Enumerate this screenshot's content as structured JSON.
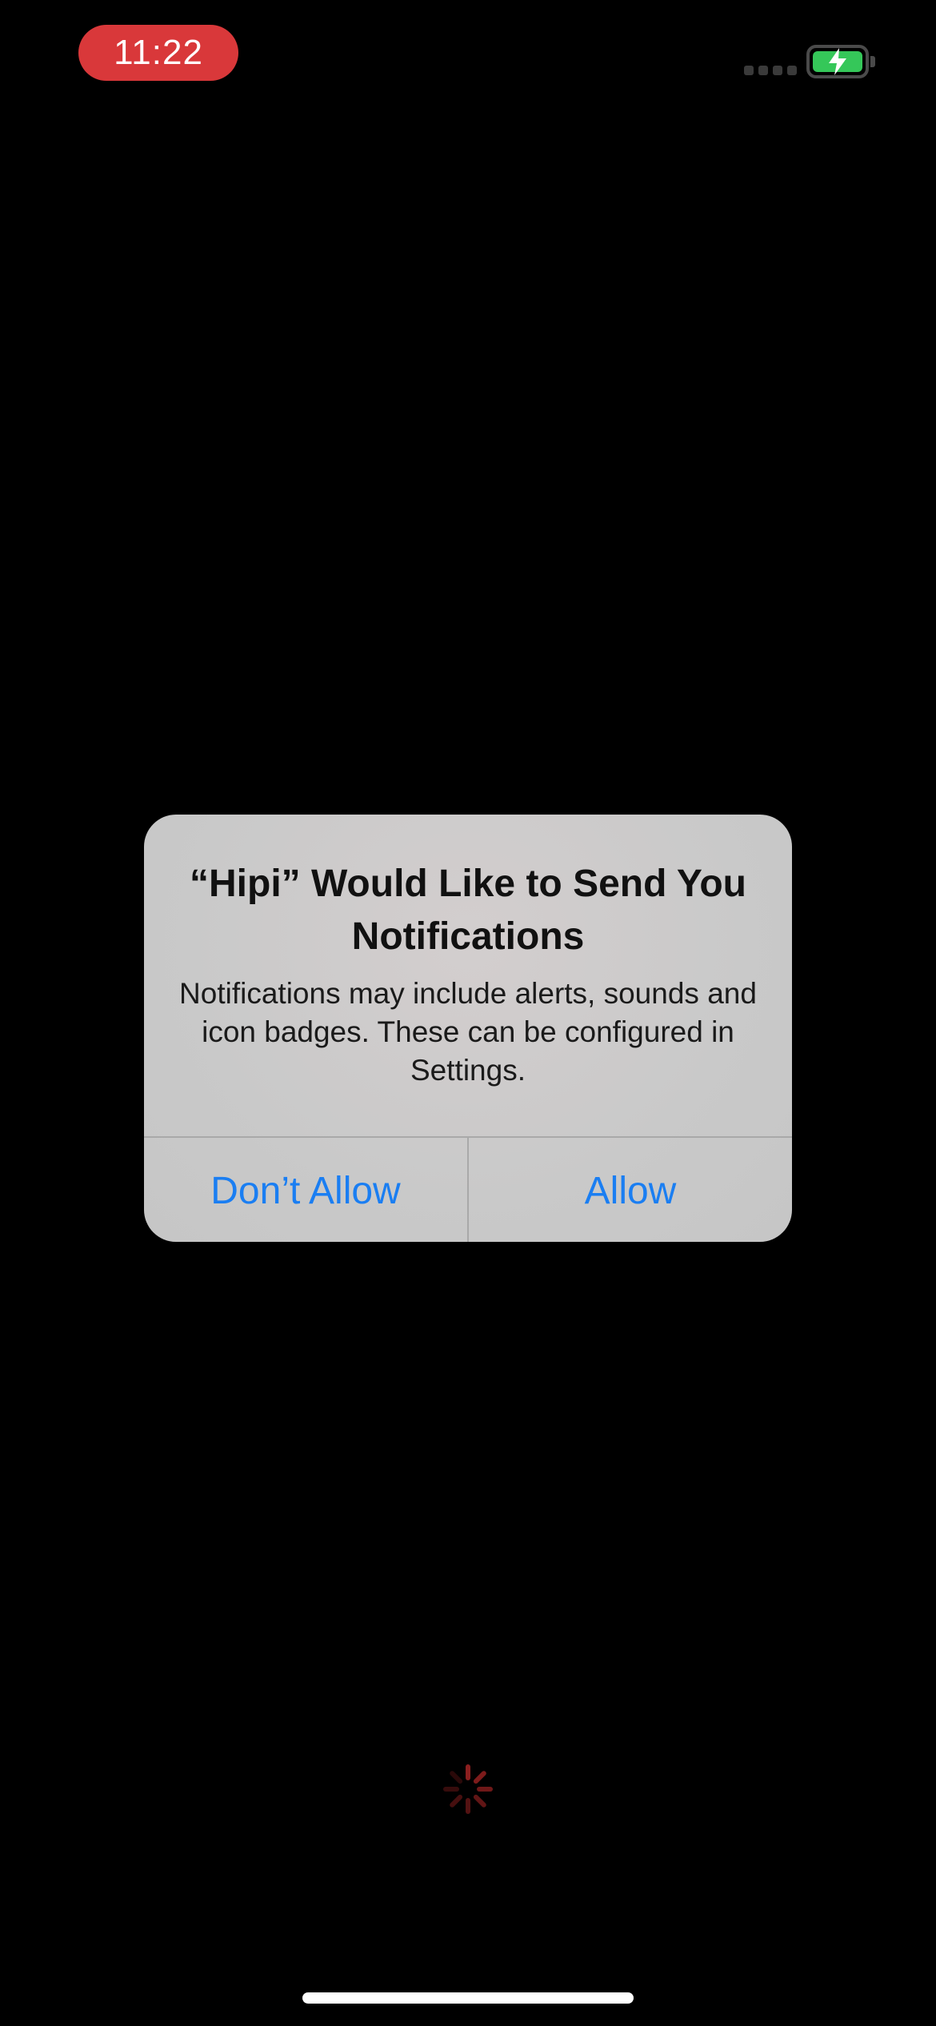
{
  "status_bar": {
    "time": "11:22",
    "battery_icon": "battery-charging-icon",
    "signal_icon": "signal-dots-icon"
  },
  "alert": {
    "title": "“Hipi” Would Like to Send You Notifications",
    "message": "Notifications may include alerts, sounds and icon badges. These can be configured in Settings.",
    "buttons": {
      "deny_label": "Don’t Allow",
      "allow_label": "Allow"
    }
  },
  "colors": {
    "time_pill": "#d9383a",
    "button_text": "#1a7ef2",
    "battery_fill": "#35c759",
    "spinner": "#8b1f1f"
  },
  "loading_icon": "spinner-icon"
}
